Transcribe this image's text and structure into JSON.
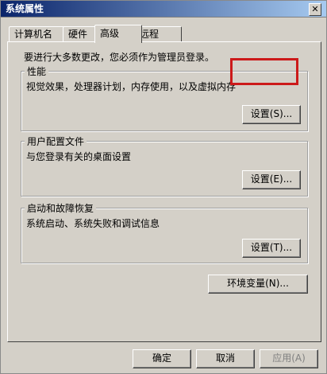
{
  "window": {
    "title": "系统属性",
    "close_symbol": "✕"
  },
  "tabs": [
    {
      "label": "计算机名"
    },
    {
      "label": "硬件"
    },
    {
      "label": "高级"
    },
    {
      "label": "远程"
    }
  ],
  "advanced": {
    "admin_note": "要进行大多数更改，您必须作为管理员登录。",
    "performance": {
      "title": "性能",
      "description": "视觉效果，处理器计划，内存使用，以及虚拟内存",
      "button": "设置(S)..."
    },
    "user_profiles": {
      "title": "用户配置文件",
      "description": "与您登录有关的桌面设置",
      "button": "设置(E)..."
    },
    "startup_recovery": {
      "title": "启动和故障恢复",
      "description": "系统启动、系统失败和调试信息",
      "button": "设置(T)..."
    },
    "env_button": "环境变量(N)..."
  },
  "footer": {
    "ok": "确定",
    "cancel": "取消",
    "apply": "应用(A)"
  },
  "colors": {
    "highlight": "#cc1a1a",
    "title_bar": "#0a246a"
  },
  "icons": {
    "close": "close-icon"
  }
}
